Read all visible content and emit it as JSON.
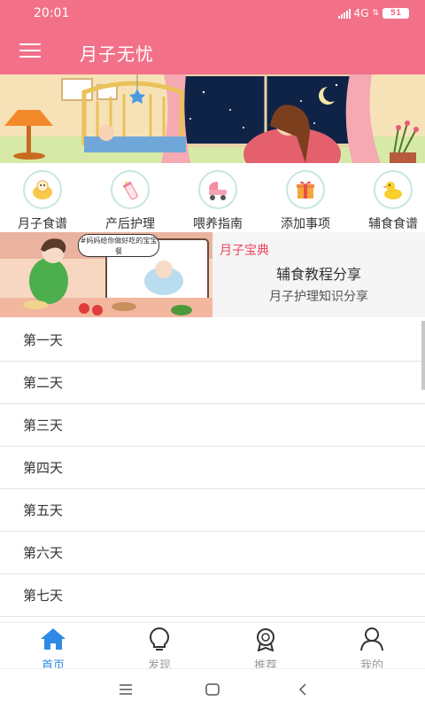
{
  "status_bar": {
    "time": "20:01",
    "network": "4G",
    "battery": "51"
  },
  "app_bar": {
    "title": "月子无忧"
  },
  "quick_menu": [
    {
      "label": "月子食谱",
      "icon": "baby-food-icon"
    },
    {
      "label": "产后护理",
      "icon": "baby-bottle-icon"
    },
    {
      "label": "喂养指南",
      "icon": "stroller-icon"
    },
    {
      "label": "添加事项",
      "icon": "gift-box-icon"
    },
    {
      "label": "辅食食谱",
      "icon": "duck-toy-icon"
    }
  ],
  "promo": {
    "tag": "月子宝典",
    "title": "辅食教程分享",
    "subtitle": "月子护理知识分享",
    "bubble_text": "#妈妈给你做好吃的宝宝餐"
  },
  "days": [
    "第一天",
    "第二天",
    "第三天",
    "第四天",
    "第五天",
    "第六天",
    "第七天"
  ],
  "tabs": [
    {
      "label": "首页",
      "icon": "home-icon",
      "active": true
    },
    {
      "label": "发现",
      "icon": "lightbulb-icon",
      "active": false
    },
    {
      "label": "推荐",
      "icon": "award-icon",
      "active": false
    },
    {
      "label": "我的",
      "icon": "user-icon",
      "active": false
    }
  ],
  "colors": {
    "primary": "#f27189",
    "tab_active": "#2e8ae6",
    "tab_inactive": "#999999",
    "tag": "#e9475f"
  }
}
